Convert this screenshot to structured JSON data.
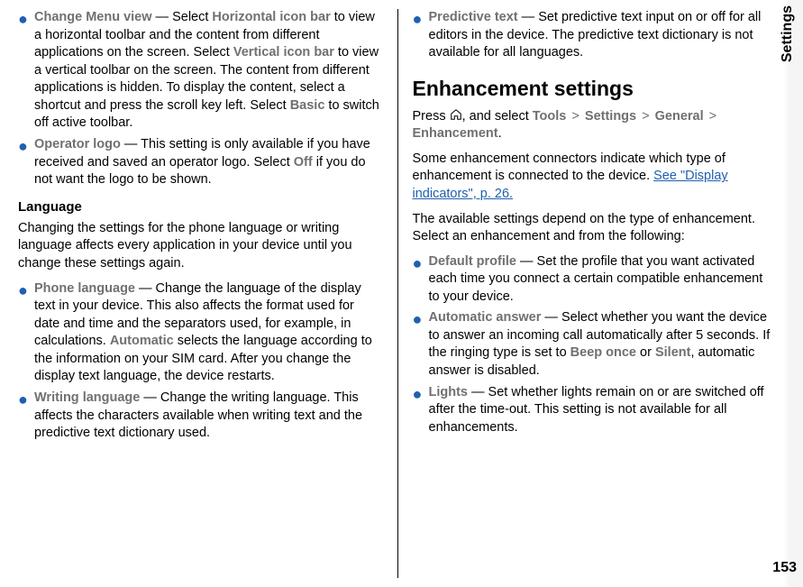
{
  "sidebar_label": "Settings",
  "page_number": "153",
  "left": {
    "bullets": [
      {
        "term": "Change Menu view",
        "text_parts": [
          " — Select ",
          {
            "t": "Horizontal icon bar",
            "style": "term"
          },
          " to view a horizontal toolbar and the content from different applications on the screen. Select ",
          {
            "t": "Vertical icon bar",
            "style": "term"
          },
          " to view a vertical toolbar on the screen. The content from different applications is hidden. To display the content, select a shortcut and press the scroll key left. Select ",
          {
            "t": "Basic",
            "style": "term"
          },
          " to switch off active toolbar."
        ]
      },
      {
        "term": "Operator logo",
        "text_parts": [
          " — This setting is only available if you have received and saved an operator logo. Select ",
          {
            "t": "Off",
            "style": "term"
          },
          " if you do not want the logo to be shown."
        ]
      }
    ],
    "subhead": "Language",
    "para": "Changing the settings for the phone language or writing language affects every application in your device until you change these settings again.",
    "bullets2": [
      {
        "term": "Phone language",
        "text_parts": [
          " — Change the language of the display text in your device. This also affects the format used for date and time and the separators used, for example, in calculations. ",
          {
            "t": "Automatic",
            "style": "term"
          },
          " selects the language according to the information on your SIM card. After you change the display text language, the device restarts."
        ]
      },
      {
        "term": "Writing language",
        "text_parts": [
          " — Change the writing language. This affects the characters available when writing text and the predictive text dictionary used."
        ]
      }
    ]
  },
  "right": {
    "bullets_top": [
      {
        "term": "Predictive text",
        "text_parts": [
          " — Set predictive text input on or off for all editors in the device. The predictive text dictionary is not available for all languages."
        ]
      }
    ],
    "section": "Enhancement settings",
    "breadcrumb": {
      "press": "Press ",
      "and_select": ", and select ",
      "items": [
        "Tools",
        "Settings",
        "General",
        "Enhancement"
      ],
      "sep": ">"
    },
    "para1_pre": "Some enhancement connectors indicate which type of enhancement is connected to the device. ",
    "para1_link": "See \"Display indicators\", p. 26.",
    "para2": "The available settings depend on the type of enhancement. Select an enhancement and from the following:",
    "bullets2": [
      {
        "term": "Default profile",
        "text_parts": [
          " — Set the profile that you want activated each time you connect a certain compatible enhancement to your device."
        ]
      },
      {
        "term": "Automatic answer",
        "text_parts": [
          " — Select whether you want the device to answer an incoming call automatically after 5 seconds. If the ringing type is set to ",
          {
            "t": "Beep once",
            "style": "term"
          },
          " or ",
          {
            "t": "Silent",
            "style": "term"
          },
          ", automatic answer is disabled."
        ]
      },
      {
        "term": "Lights",
        "text_parts": [
          " — Set whether lights remain on or are switched off after the time-out. This setting is not available for all enhancements."
        ]
      }
    ]
  }
}
